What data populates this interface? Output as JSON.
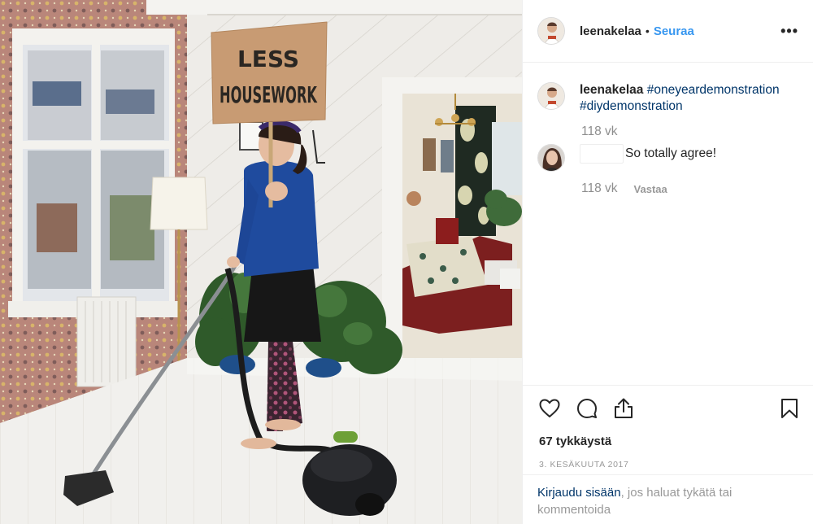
{
  "photo": {
    "sign_line1": "LESS",
    "sign_line2": "HOUSEWORK"
  },
  "header": {
    "username": "leenakelaa",
    "separator": "•",
    "follow_label": "Seuraa",
    "more_label": "•••"
  },
  "caption": {
    "username": "leenakelaa",
    "hashtag1": "#oneyeardemonstration",
    "hashtag2": "#diydemonstration",
    "age": "118 vk"
  },
  "comment": {
    "text": "So totally agree!",
    "age": "118 vk",
    "reply_label": "Vastaa"
  },
  "actions": {
    "icons": [
      "heart-icon",
      "comment-icon",
      "share-icon",
      "bookmark-icon"
    ],
    "likes": "67 tykkäystä",
    "date": "3. KESÄKUUTA 2017"
  },
  "login": {
    "link": "Kirjaudu sisään",
    "rest": ", jos haluat tykätä tai kommentoida"
  },
  "colors": {
    "link_blue": "#3897f0",
    "hashtag_navy": "#003569",
    "meta_gray": "#8e8e8e",
    "border": "#efefef"
  }
}
